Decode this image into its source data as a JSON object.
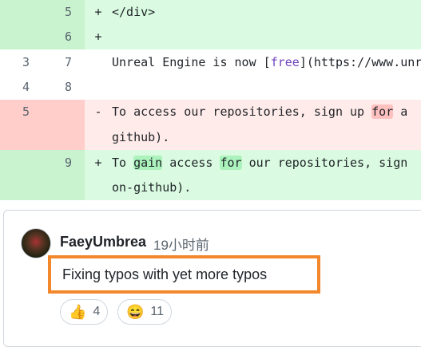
{
  "diff_lines": [
    {
      "type": "add",
      "old": "",
      "new": "5",
      "sign": "+",
      "segments": [
        {
          "t": "</div>",
          "h": ""
        }
      ]
    },
    {
      "type": "add",
      "old": "",
      "new": "6",
      "sign": "+",
      "segments": [
        {
          "t": "",
          "h": ""
        }
      ]
    },
    {
      "type": "ctx",
      "old": "3",
      "new": "7",
      "sign": "",
      "segments": [
        {
          "t": "Unreal Engine is now [",
          "h": ""
        },
        {
          "t": "free",
          "h": "link"
        },
        {
          "t": "](https://www.unrealengine.com",
          "h": ""
        }
      ]
    },
    {
      "type": "ctx",
      "old": "4",
      "new": "8",
      "sign": "",
      "segments": [
        {
          "t": "",
          "h": ""
        }
      ]
    },
    {
      "type": "del",
      "old": "5",
      "new": "",
      "sign": "-",
      "segments": [
        {
          "t": "To access our repositories, sign up ",
          "h": ""
        },
        {
          "t": "for",
          "h": "del"
        },
        {
          "t": " a",
          "h": ""
        }
      ]
    },
    {
      "type": "del",
      "old": "",
      "new": "",
      "sign": "",
      "segments": [
        {
          "t": "github).",
          "h": ""
        }
      ]
    },
    {
      "type": "add",
      "old": "",
      "new": "9",
      "sign": "+",
      "segments": [
        {
          "t": "To ",
          "h": ""
        },
        {
          "t": "gain",
          "h": "add"
        },
        {
          "t": " access ",
          "h": ""
        },
        {
          "t": "for",
          "h": "add"
        },
        {
          "t": " our repositories, sign",
          "h": ""
        }
      ]
    },
    {
      "type": "add",
      "old": "",
      "new": "",
      "sign": "",
      "segments": [
        {
          "t": "on-github).",
          "h": ""
        }
      ]
    }
  ],
  "comment": {
    "author": "FaeyUmbrea",
    "time": "19小时前",
    "body": "Fixing typos with yet more typos",
    "reactions": [
      {
        "emoji": "👍",
        "icon": "thumbs-up-icon",
        "count": "4"
      },
      {
        "emoji": "😄",
        "icon": "laugh-icon",
        "count": "11"
      }
    ]
  },
  "colors": {
    "accent_box": "#f2872c",
    "add_bg": "#dafbe1",
    "del_bg": "#ffebe9"
  }
}
